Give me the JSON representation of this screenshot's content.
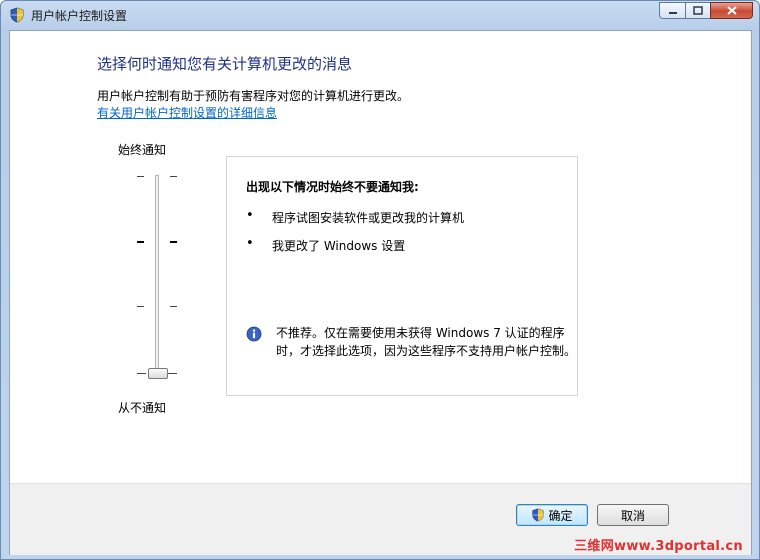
{
  "window": {
    "title": "用户帐户控制设置"
  },
  "main": {
    "heading": "选择何时通知您有关计算机更改的消息",
    "description": "用户帐户控制有助于预防有害程序对您的计算机进行更改。",
    "link": "有关用户帐户控制设置的详细信息"
  },
  "slider": {
    "top_label": "始终通知",
    "bottom_label": "从不通知",
    "levels": 4,
    "selected_level": 1
  },
  "info": {
    "title": "出现以下情况时始终不要通知我:",
    "bullets": [
      "程序试图安装软件或更改我的计算机",
      "我更改了 Windows 设置"
    ],
    "note": "不推荐。仅在需要使用未获得 Windows 7 认证的程序时，才选择此选项，因为这些程序不支持用户帐户控制。"
  },
  "buttons": {
    "ok": "确定",
    "cancel": "取消"
  },
  "watermark": "三维网www.3dportal.cn",
  "colors": {
    "heading": "#1e3287",
    "link": "#0066cc",
    "watermark": "#e03030"
  }
}
